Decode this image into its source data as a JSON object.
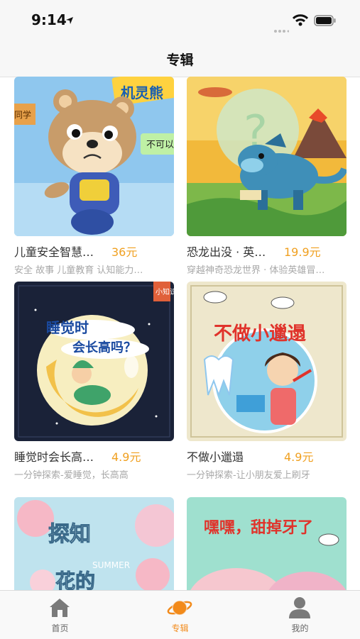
{
  "status": {
    "time": "9:14"
  },
  "header": {
    "title": "专辑"
  },
  "albums": [
    {
      "name": "儿童安全智慧…",
      "price": "36元",
      "desc": "安全 故事 儿童教育 认知能力…",
      "thumb": {
        "text1": "机灵熊",
        "text2": "不可以",
        "text3": "同学",
        "bg": "#8fc7ee"
      }
    },
    {
      "name": "恐龙出没 · 英…",
      "price": "19.9元",
      "desc": "穿越神奇恐龙世界 · 体验英雄冒…",
      "thumb": {
        "bg": "#f2b93b"
      }
    },
    {
      "name": "睡觉时会长高…",
      "price": "4.9元",
      "desc": "一分钟探索-爱睡觉，长高高",
      "thumb": {
        "text1": "睡觉时",
        "text2": "会长高吗？",
        "text3": "小知识",
        "bg": "#1a2238"
      }
    },
    {
      "name": "不做小邋遢",
      "price": "4.9元",
      "desc": "一分钟探索-让小朋友爱上刷牙",
      "thumb": {
        "text1": "不做小邋遢",
        "bg": "#eee7cc"
      }
    },
    {
      "name": "",
      "price": "",
      "desc": "",
      "thumb": {
        "text1": "探知",
        "text2": "花的",
        "text3": "SUMMER",
        "bg": "#bfe3ee"
      }
    },
    {
      "name": "",
      "price": "",
      "desc": "",
      "thumb": {
        "text1": "嘿嘿，甜掉牙了",
        "bg": "#9fe0cf"
      }
    }
  ],
  "tabbar": {
    "tabs": [
      {
        "label": "首页"
      },
      {
        "label": "专辑"
      },
      {
        "label": "我的"
      }
    ]
  },
  "colors": {
    "accent": "#f28a1a",
    "price": "#f0a020"
  }
}
